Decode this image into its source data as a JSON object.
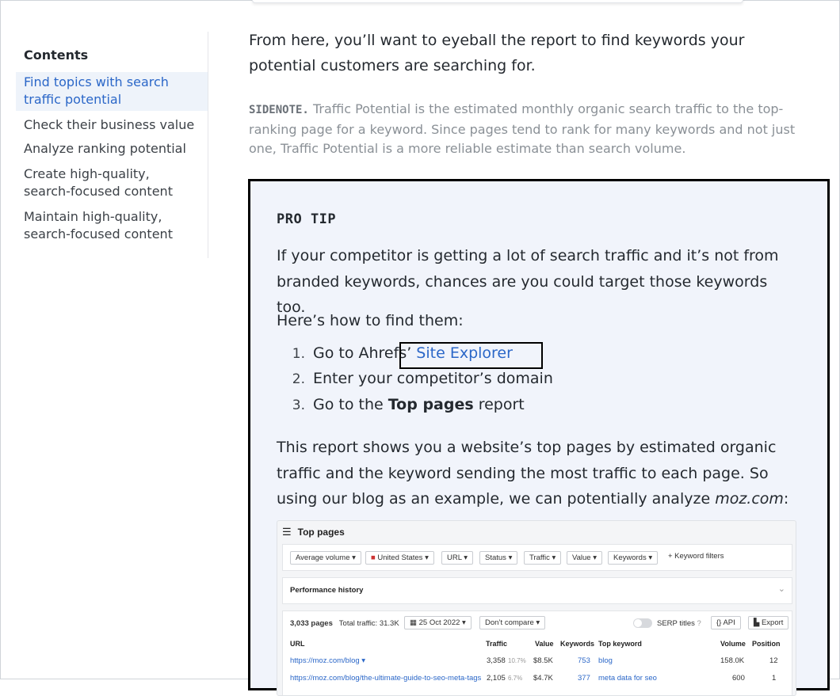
{
  "toc": {
    "title": "Contents",
    "items": [
      {
        "label": "Find topics with search traffic potential",
        "active": true
      },
      {
        "label": "Check their business value"
      },
      {
        "label": "Analyze ranking potential"
      },
      {
        "label": "Create high-quality, search-focused content"
      },
      {
        "label": "Maintain high-quality, search-focused content"
      }
    ]
  },
  "intro": "From here, you’ll want to eyeball the report to find keywords your potential customers are searching for.",
  "sidenote": {
    "tag": "SIDENOTE.",
    "text": " Traffic Potential is the estimated monthly organic search traffic to the top-ranking page for a keyword. Since pages tend to rank for many keywords and not just one, Traffic Potential is a more reliable estimate than search volume."
  },
  "protip": {
    "heading": "PRO TIP",
    "para1": "If your competitor is getting a lot of search traffic and it’s not from branded keywords, chances are you could target those keywords too.",
    "para2": "Here’s how to find them:",
    "steps": [
      {
        "num": "1.",
        "text": "Go to Ahrefs’ ",
        "link": "Site Explorer"
      },
      {
        "num": "2.",
        "text": "Enter your competitor’s domain"
      },
      {
        "num": "3.",
        "text_before": "Go to the ",
        "bold": "Top pages",
        "text_after": " report"
      }
    ],
    "para3_before": "This report shows you a website’s top pages by estimated organic traffic and the keyword sending the most traffic to each page. So using our blog as an example, we can potentially analyze ",
    "para3_em": "moz.com",
    "para3_after": ":"
  },
  "screenshot": {
    "title": "Top pages",
    "filters": [
      "Average volume ▾",
      "United States ▾",
      "URL ▾",
      "Status ▾",
      "Traffic ▾",
      "Value ▾",
      "Keywords ▾"
    ],
    "keyword_filters": "+ Keyword filters",
    "performance": "Performance history",
    "pages": "3,033 pages",
    "total_traffic": "Total traffic: 31.3K",
    "date": "25 Oct 2022 ▾",
    "compare": "Don’t compare ▾",
    "serp_titles": "SERP titles",
    "api": "API",
    "export": "Export",
    "columns": [
      "URL",
      "Traffic",
      "Value",
      "Keywords",
      "Top keyword",
      "Volume",
      "Position"
    ],
    "rows": [
      {
        "url": "https://moz.com/blog ▾",
        "traffic": "3,358",
        "pct": "10.7%",
        "value": "$8.5K",
        "keywords": "753",
        "top_keyword": "blog",
        "volume": "158.0K",
        "position": "12"
      },
      {
        "url": "https://moz.com/blog/the-ultimate-guide-to-seo-meta-tags",
        "traffic": "2,105",
        "pct": "6.7%",
        "value": "$4.7K",
        "keywords": "377",
        "top_keyword": "meta data for seo",
        "volume": "600",
        "position": "1"
      }
    ]
  }
}
